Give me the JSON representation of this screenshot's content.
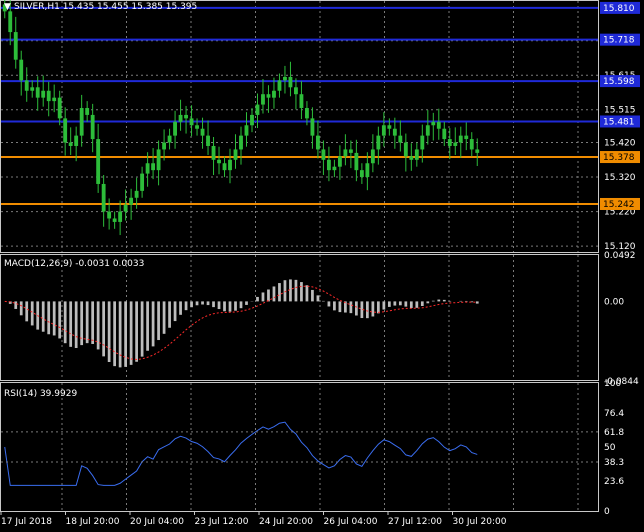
{
  "price_panel": {
    "header": "SILVER,H1  15.435 15.455 15.385 15.395",
    "price_axis": [
      "15.715",
      "15.615",
      "15.515",
      "15.420",
      "15.320",
      "15.220",
      "15.120"
    ],
    "line_tags": [
      "15.810",
      "15.718",
      "15.598",
      "15.481",
      "15.378",
      "15.242"
    ],
    "current_price": "15.395",
    "h_lines": [
      {
        "price": 15.81,
        "color": "#1f2ad8"
      },
      {
        "price": 15.718,
        "color": "#1f2ad8"
      },
      {
        "price": 15.598,
        "color": "#1f2ad8"
      },
      {
        "price": 15.481,
        "color": "#1f2ad8"
      },
      {
        "price": 15.378,
        "color": "#f08c00"
      },
      {
        "price": 15.242,
        "color": "#f08c00"
      }
    ],
    "candle_color": "#2dbd3a"
  },
  "macd_panel": {
    "header": "MACD(12,26,9) -0.0031 0.0033",
    "axis": [
      "0.0492",
      "0.00",
      "-0.0844"
    ],
    "bar_color": "#bdbdbd",
    "signal_color": "#ff2a2a"
  },
  "rsi_panel": {
    "header": "RSI(14) 39.9929",
    "axis": [
      "100",
      "76.4",
      "61.8",
      "50",
      "38.3",
      "23.6",
      "0"
    ],
    "line_color": "#3a6df0"
  },
  "time_axis": [
    "17 Jul 2018",
    "18 Jul 20:00",
    "20 Jul 04:00",
    "23 Jul 12:00",
    "24 Jul 20:00",
    "26 Jul 04:00",
    "27 Jul 12:00",
    "30 Jul 20:00"
  ],
  "ui": {
    "collapse_arrow": "▼"
  },
  "chart_data": [
    {
      "type": "line",
      "name": "SILVER,H1",
      "x": [
        "17 Jul 2018",
        "",
        "",
        "",
        "",
        "",
        "",
        "",
        "",
        "",
        "",
        "",
        "",
        "",
        "",
        "",
        "18 Jul 20:00",
        "",
        "",
        "",
        "",
        "",
        "",
        "",
        "",
        "",
        "",
        "",
        "",
        "",
        "",
        "",
        "20 Jul 04:00",
        "",
        "",
        "",
        "",
        "",
        "",
        "",
        "",
        "",
        "",
        "",
        "",
        "",
        "",
        "",
        "23 Jul 12:00",
        "",
        "",
        "",
        "",
        "",
        "",
        "",
        "",
        "",
        "",
        "",
        "",
        "",
        "",
        "",
        "24 Jul 20:00",
        "",
        "",
        "",
        "",
        "",
        "",
        "",
        "",
        "",
        "",
        "",
        "",
        "",
        "",
        "",
        "26 Jul 04:00",
        "",
        "",
        "",
        "",
        "",
        "",
        "",
        "",
        "",
        "",
        "",
        "",
        "",
        "",
        "",
        "27 Jul 12:00",
        "",
        "",
        "",
        "",
        "",
        "",
        "",
        "",
        "",
        "",
        "",
        "",
        "",
        "",
        "",
        "30 Jul 20:00",
        "",
        "",
        "",
        "",
        "",
        "",
        "",
        "",
        "",
        "",
        ""
      ],
      "close": [
        15.8,
        15.74,
        15.66,
        15.6,
        15.57,
        15.58,
        15.55,
        15.57,
        15.54,
        15.55,
        15.49,
        15.42,
        15.41,
        15.44,
        15.52,
        15.5,
        15.43,
        15.3,
        15.22,
        15.2,
        15.19,
        15.22,
        15.24,
        15.26,
        15.28,
        15.33,
        15.36,
        15.34,
        15.4,
        15.42,
        15.44,
        15.48,
        15.5,
        15.49,
        15.47,
        15.46,
        15.44,
        15.41,
        15.37,
        15.36,
        15.34,
        15.37,
        15.4,
        15.44,
        15.47,
        15.5,
        15.53,
        15.56,
        15.55,
        15.57,
        15.6,
        15.61,
        15.58,
        15.56,
        15.52,
        15.49,
        15.44,
        15.4,
        15.37,
        15.34,
        15.35,
        15.38,
        15.4,
        15.39,
        15.34,
        15.32,
        15.36,
        15.4,
        15.44,
        15.47,
        15.46,
        15.44,
        15.42,
        15.38,
        15.37,
        15.4,
        15.44,
        15.47,
        15.48,
        15.46,
        15.43,
        15.41,
        15.42,
        15.44,
        15.43,
        15.4,
        15.39
      ],
      "ylim": [
        15.1,
        15.83
      ]
    }
  ]
}
